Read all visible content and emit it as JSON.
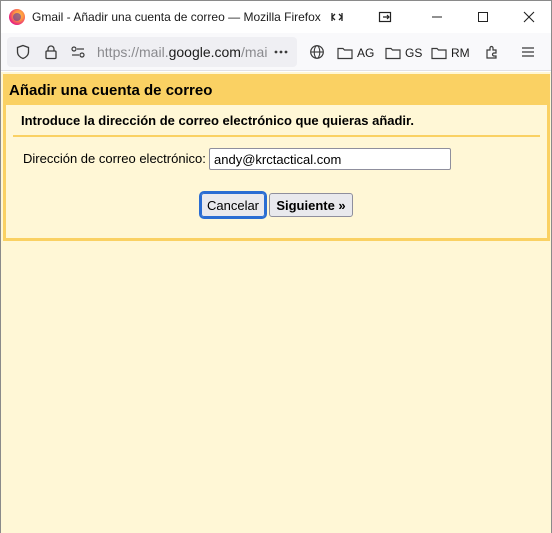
{
  "window": {
    "title": "Gmail - Añadir una cuenta de correo — Mozilla Firefox"
  },
  "navbar": {
    "url_prefix": "https://mail.",
    "url_domain": "google.com",
    "url_suffix": "/mai",
    "bookmarks": [
      {
        "label": "AG",
        "icon": "folder-icon"
      },
      {
        "label": "GS",
        "icon": "folder-icon"
      },
      {
        "label": "RM",
        "icon": "folder-icon"
      }
    ]
  },
  "dialog": {
    "title": "Añadir una cuenta de correo",
    "instruction": "Introduce la dirección de correo electrónico que quieras añadir.",
    "email_label": "Dirección de correo electrónico:",
    "email_value": "andy@krctactical.com",
    "cancel_label": "Cancelar",
    "next_label": "Siguiente »"
  },
  "colors": {
    "header_bg": "#fad163",
    "content_bg": "#fff7d6",
    "focus_ring": "#2a6dd3"
  }
}
